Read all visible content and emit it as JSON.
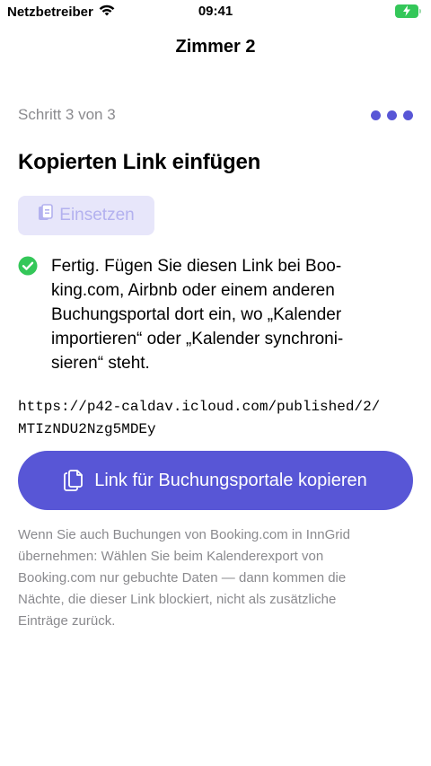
{
  "status_bar": {
    "carrier": "Netzbetreiber",
    "time": "09:41",
    "icons": [
      "wifi-icon",
      "battery-charging-icon"
    ]
  },
  "nav": {
    "title": "Zimmer 2"
  },
  "step": {
    "label": "Schritt 3 von 3",
    "dots": 3
  },
  "main": {
    "heading": "Kopierten Link einfügen",
    "paste_button": {
      "label": "Einsetzen",
      "icon": "paste-icon",
      "enabled": false
    },
    "success_message": "Fertig. Fügen Sie diesen Link bei Boo-\nking.com, Airbnb oder einem anderen\nBuchungsportal dort ein, wo „Kalender\nimportieren“ oder „Kalender synchroni-\nsieren“ steht.",
    "url": "https://p42-caldav.icloud.com/published/2/\nMTIzNDU2Nzg5MDEy",
    "copy_button": {
      "label": "Link für Buchungsportale kopieren",
      "icon": "copy-icon"
    },
    "footnote": "Wenn Sie auch Buchungen von Booking.com in InnGrid\nübernehmen: Wählen Sie beim Kalenderexport von\nBooking.com nur gebuchte Daten — dann kommen die\nNächte, die dieser Link blockiert, nicht als zusätzliche\nEinträge zurück."
  },
  "colors": {
    "accent": "#5856d6",
    "accent_disabled_bg": "#e7e6fa",
    "accent_disabled_text": "#b3b1ef",
    "success": "#34c759",
    "secondary_text": "#8a8a8e"
  }
}
